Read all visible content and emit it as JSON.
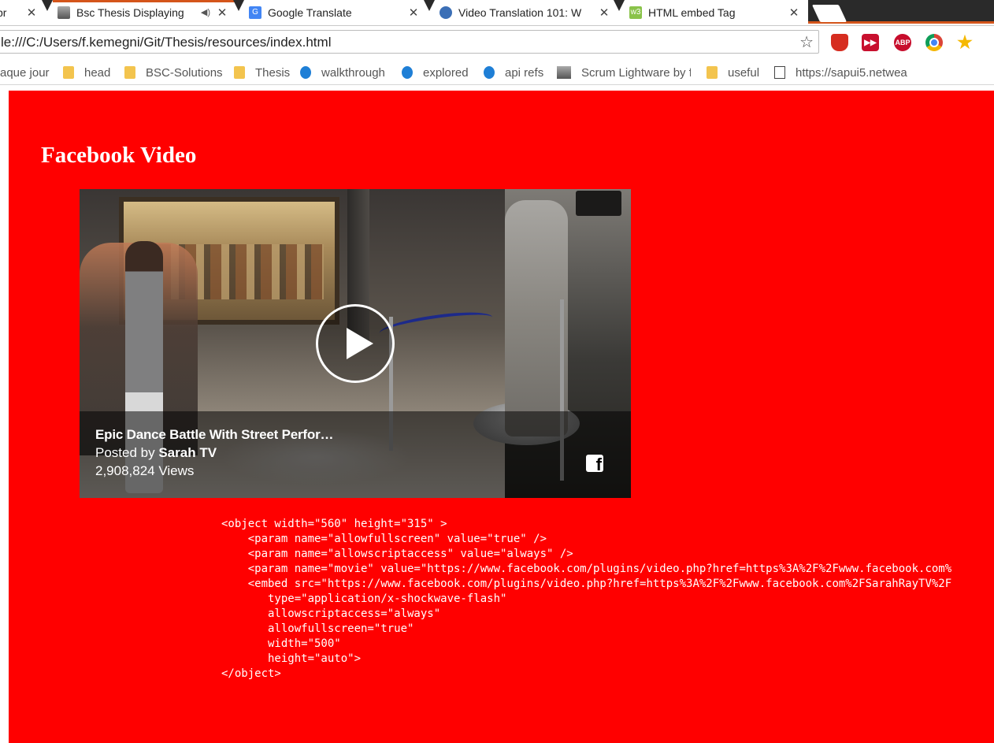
{
  "tabs": [
    {
      "title": "pr",
      "favicon": "page-icon"
    },
    {
      "title": "Bsc Thesis Displaying",
      "favicon": "person-icon",
      "audio": "◀)"
    },
    {
      "title": "Google Translate",
      "favicon": "google-translate-icon"
    },
    {
      "title": "Video Translation 101: W",
      "favicon": "globe-icon"
    },
    {
      "title": "HTML embed Tag",
      "favicon": "w3schools-icon",
      "fav_text": "w3"
    }
  ],
  "close_glyph": "✕",
  "address_bar": {
    "url": "le:///C:/Users/f.kemegni/Git/Thesis/resources/index.html",
    "star_glyph": "☆"
  },
  "extensions": [
    {
      "name": "stop-extension-icon",
      "color": "#d62d20",
      "text": ""
    },
    {
      "name": "forward-extension-icon",
      "color": "#c8102e",
      "text": ""
    },
    {
      "name": "adblock-plus-icon",
      "color": "#c70d2c",
      "text": "ABP"
    },
    {
      "name": "chrome-icon",
      "color": "#4caf50",
      "text": ""
    },
    {
      "name": "favorite-star-icon",
      "color": "#f5b800",
      "text": ""
    }
  ],
  "bookmarks": [
    {
      "label": "aque jour",
      "icon": "none"
    },
    {
      "label": "head",
      "icon": "folder"
    },
    {
      "label": "BSC-Solutions",
      "icon": "folder"
    },
    {
      "label": "Thesis",
      "icon": "folder"
    },
    {
      "label": "walkthrough",
      "icon": "globe"
    },
    {
      "label": "explored",
      "icon": "globe"
    },
    {
      "label": "api refs",
      "icon": "globe"
    },
    {
      "label": "Scrum Lightware by f",
      "icon": "person"
    },
    {
      "label": "useful",
      "icon": "folder"
    },
    {
      "label": "https://sapui5.netwea",
      "icon": "doc"
    }
  ],
  "page": {
    "heading": "Facebook Video",
    "background": "#ff0000",
    "video": {
      "title": "Epic Dance Battle With Street Perfor…",
      "posted_prefix": "Posted by",
      "author": "Sarah TV",
      "views": "2,908,824 Views",
      "fb_logo": "f"
    },
    "code_lines": [
      "<object width=\"560\" height=\"315\" >",
      "    <param name=\"allowfullscreen\" value=\"true\" />",
      "    <param name=\"allowscriptaccess\" value=\"always\" />",
      "    <param name=\"movie\" value=\"https://www.facebook.com/plugins/video.php?href=https%3A%2F%2Fwww.facebook.com%",
      "    <embed src=\"https://www.facebook.com/plugins/video.php?href=https%3A%2F%2Fwww.facebook.com%2FSarahRayTV%2F",
      "       type=\"application/x-shockwave-flash\"",
      "       allowscriptaccess=\"always\"",
      "       allowfullscreen=\"true\"",
      "       width=\"500\"",
      "       height=\"auto\">",
      "</object>"
    ]
  }
}
